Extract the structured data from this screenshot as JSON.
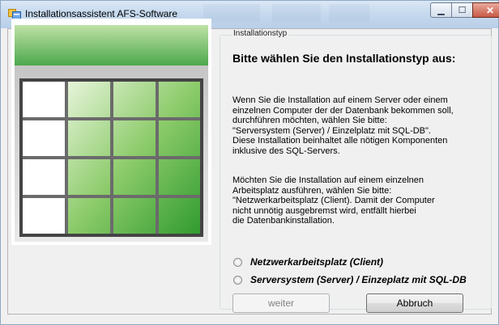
{
  "window": {
    "title": "Installationsassistent AFS-Software",
    "minimize_glyph": "▁",
    "maximize_glyph": "☐",
    "close_glyph": "✕"
  },
  "group": {
    "legend": "Installationstyp",
    "heading": "Bitte wählen Sie den Installationstyp aus:"
  },
  "paragraph1": [
    "Wenn Sie die Installation auf einem Server oder einem",
    "einzelnen Computer der der Datenbank bekommen soll,",
    "durchführen möchten, wählen Sie bitte:",
    "\"Serversystem (Server) / Einzelplatz mit SQL-DB\".",
    "Diese Installation beinhaltet alle nötigen Komponenten",
    "inklusive des SQL-Servers."
  ],
  "paragraph2": [
    "Möchten Sie die Installation auf einem einzelnen",
    "Arbeitsplatz ausführen, wählen Sie bitte:",
    "\"Netzwerkarbeitsplatz (Client). Damit der Computer",
    "nicht unnötig ausgebremst wird, entfällt hierbei",
    "die Datenbankinstallation."
  ],
  "options": [
    {
      "label": "Netzwerkarbeitsplatz (Client)",
      "selected": false
    },
    {
      "label": "Serversystem (Server) / Einzeplatz mit SQL-DB",
      "selected": false
    }
  ],
  "buttons": {
    "next": "weiter",
    "cancel": "Abbruch"
  },
  "icons": {
    "title": "installer-app-icon",
    "logo": "spreadsheet-table-graphic"
  },
  "colors": {
    "logo_green_light": "#d5ecc4",
    "logo_green_dark": "#2f9a2f",
    "logo_header_green": "#4ca84c"
  }
}
